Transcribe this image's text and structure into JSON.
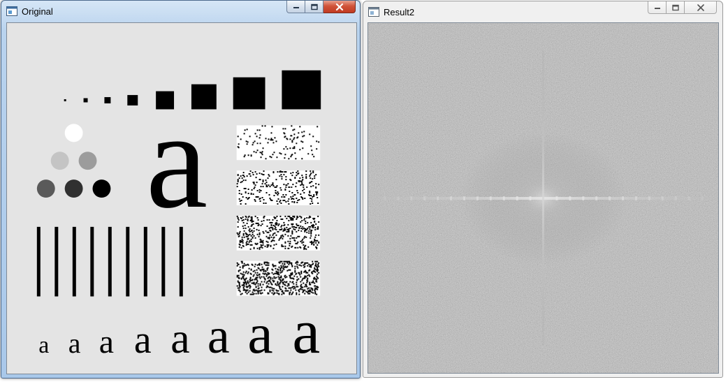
{
  "windows": [
    {
      "title": "Original",
      "active": true
    },
    {
      "title": "Result2",
      "active": false
    }
  ],
  "icons": {
    "app": "app-window-icon",
    "minimize": "minimize-icon",
    "maximize": "maximize-icon",
    "close": "close-icon"
  },
  "original_image": {
    "glyph": "a",
    "squares_count": 8,
    "circles_count": 6,
    "bars_count": 9,
    "noise_blocks_count": 4,
    "small_glyphs_count": 8
  },
  "colors": {
    "original_bg": "#e4e4e4",
    "spectrum_bg": "#808080",
    "ink": "#000000"
  }
}
